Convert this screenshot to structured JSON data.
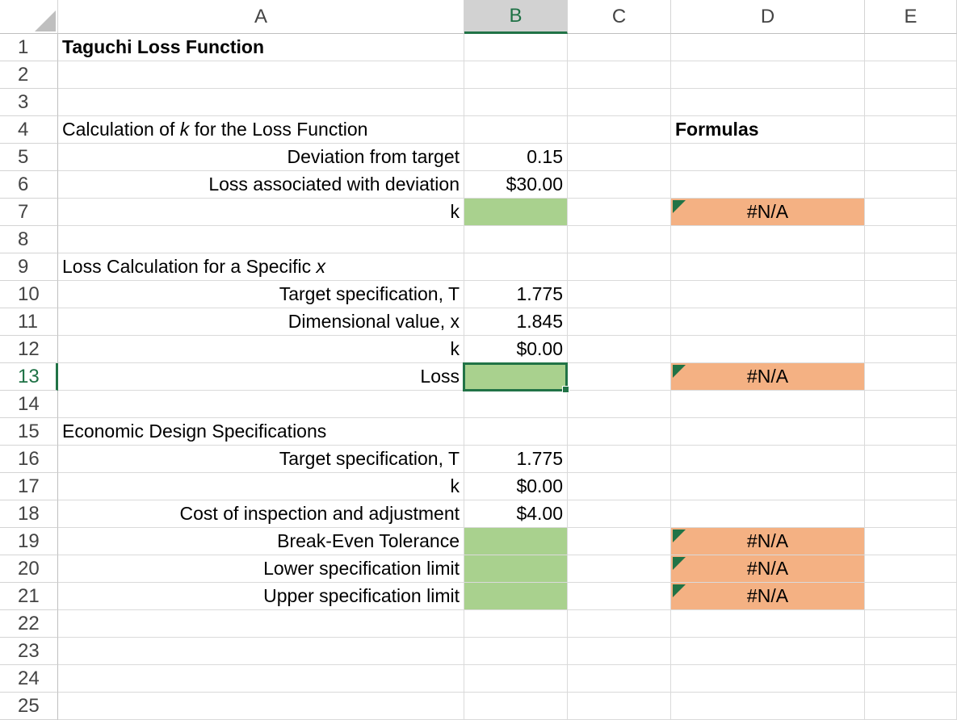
{
  "columns": [
    "A",
    "B",
    "C",
    "D",
    "E"
  ],
  "selected_column": "B",
  "selected_row": "13",
  "rows": [
    "1",
    "2",
    "3",
    "4",
    "5",
    "6",
    "7",
    "8",
    "9",
    "10",
    "11",
    "12",
    "13",
    "14",
    "15",
    "16",
    "17",
    "18",
    "19",
    "20",
    "21",
    "22",
    "23",
    "24",
    "25"
  ],
  "title": "Taguchi Loss Function",
  "formulas_header": "Formulas",
  "section1": {
    "heading_prefix": "Calculation of ",
    "heading_var": "k",
    "heading_suffix": " for the Loss Function",
    "deviation_label": "Deviation from target",
    "deviation_value": "0.15",
    "loss_label": "Loss associated with deviation",
    "loss_value": "$30.00",
    "k_label": "k",
    "k_value": "",
    "k_formula": "#N/A"
  },
  "section2": {
    "heading_prefix": "Loss Calculation for a Specific ",
    "heading_var": "x",
    "target_label": "Target specification, T",
    "target_value": "1.775",
    "dim_label": "Dimensional value, x",
    "dim_value": "1.845",
    "k_label": "k",
    "k_value": "$0.00",
    "loss_label": "Loss",
    "loss_value": "",
    "loss_formula": "#N/A"
  },
  "section3": {
    "heading": "Economic Design Specifications",
    "target_label": "Target specification, T",
    "target_value": "1.775",
    "k_label": "k",
    "k_value": "$0.00",
    "cost_label": "Cost of inspection and adjustment",
    "cost_value": "$4.00",
    "bet_label": "Break-Even Tolerance",
    "bet_formula": "#N/A",
    "lsl_label": "Lower specification limit",
    "lsl_formula": "#N/A",
    "usl_label": "Upper specification limit",
    "usl_formula": "#N/A"
  },
  "colors": {
    "input_fill": "#a9d18e",
    "formula_fill": "#f4b183",
    "selection": "#217346"
  }
}
